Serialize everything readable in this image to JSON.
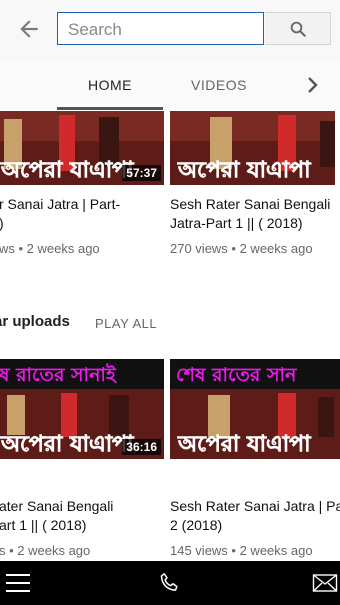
{
  "search": {
    "placeholder": "Search",
    "value": ""
  },
  "tabs": [
    {
      "label": "HOME",
      "active": true
    },
    {
      "label": "VIDEOS",
      "active": false
    }
  ],
  "row1": [
    {
      "title_line1": "r Sanai Jatra | Part-",
      "title_line2": ")",
      "meta": "ws • 2 weeks ago",
      "duration": "57:37",
      "thumb_text": "অপেরা যাএাপা"
    },
    {
      "title_line1": "Sesh Rater Sanai Bengali",
      "title_line2": "Jatra-Part 1 || ( 2018)",
      "meta": "270 views • 2 weeks ago",
      "duration": "",
      "thumb_text": "অপেরা যাএাপা"
    }
  ],
  "section": {
    "title": "ar uploads",
    "play_all": "PLAY ALL"
  },
  "row2": [
    {
      "title_line1": "ater Sanai Bengali",
      "title_line2": "art 1 || ( 2018)",
      "meta": "s • 2 weeks ago",
      "duration": "36:16",
      "thumb_top_text": "ষ রাতের সানাই",
      "thumb_text": "অপেরা যাএাপা"
    },
    {
      "title_line1": "Sesh Rater Sanai Jatra | Pa",
      "title_line2": "2 (2018)",
      "meta": "145 views • 2 weeks ago",
      "duration": "",
      "thumb_top_text": "শেষ রাতের সান",
      "thumb_text": "অপেরা যাএাপা"
    }
  ],
  "colors": {
    "accent": "#1c62b9",
    "thumb_bg": "#6b1f1b",
    "thumb_caption": "#ff1a1a",
    "thumb_top_caption": "#e81be8"
  },
  "icons": {
    "back": "arrow-left-icon",
    "search": "magnifier-icon",
    "next": "chevron-right-icon",
    "menu": "hamburger-icon",
    "phone": "phone-icon",
    "mail": "envelope-icon"
  }
}
